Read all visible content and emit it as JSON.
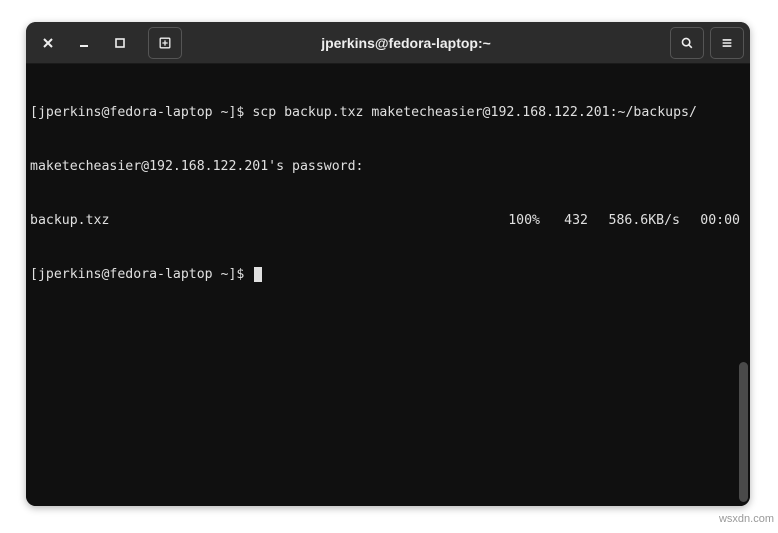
{
  "window": {
    "title": "jperkins@fedora-laptop:~"
  },
  "terminal": {
    "prompt1": "[jperkins@fedora-laptop ~]$ ",
    "command1": "scp backup.txz maketecheasier@192.168.122.201:~/backups/",
    "line2": "maketecheasier@192.168.122.201's password:",
    "transfer": {
      "file": "backup.txz",
      "percent": "100%",
      "size": "432",
      "speed": "586.6KB/s",
      "time": "00:00"
    },
    "prompt2": "[jperkins@fedora-laptop ~]$ "
  },
  "watermark": "wsxdn.com"
}
